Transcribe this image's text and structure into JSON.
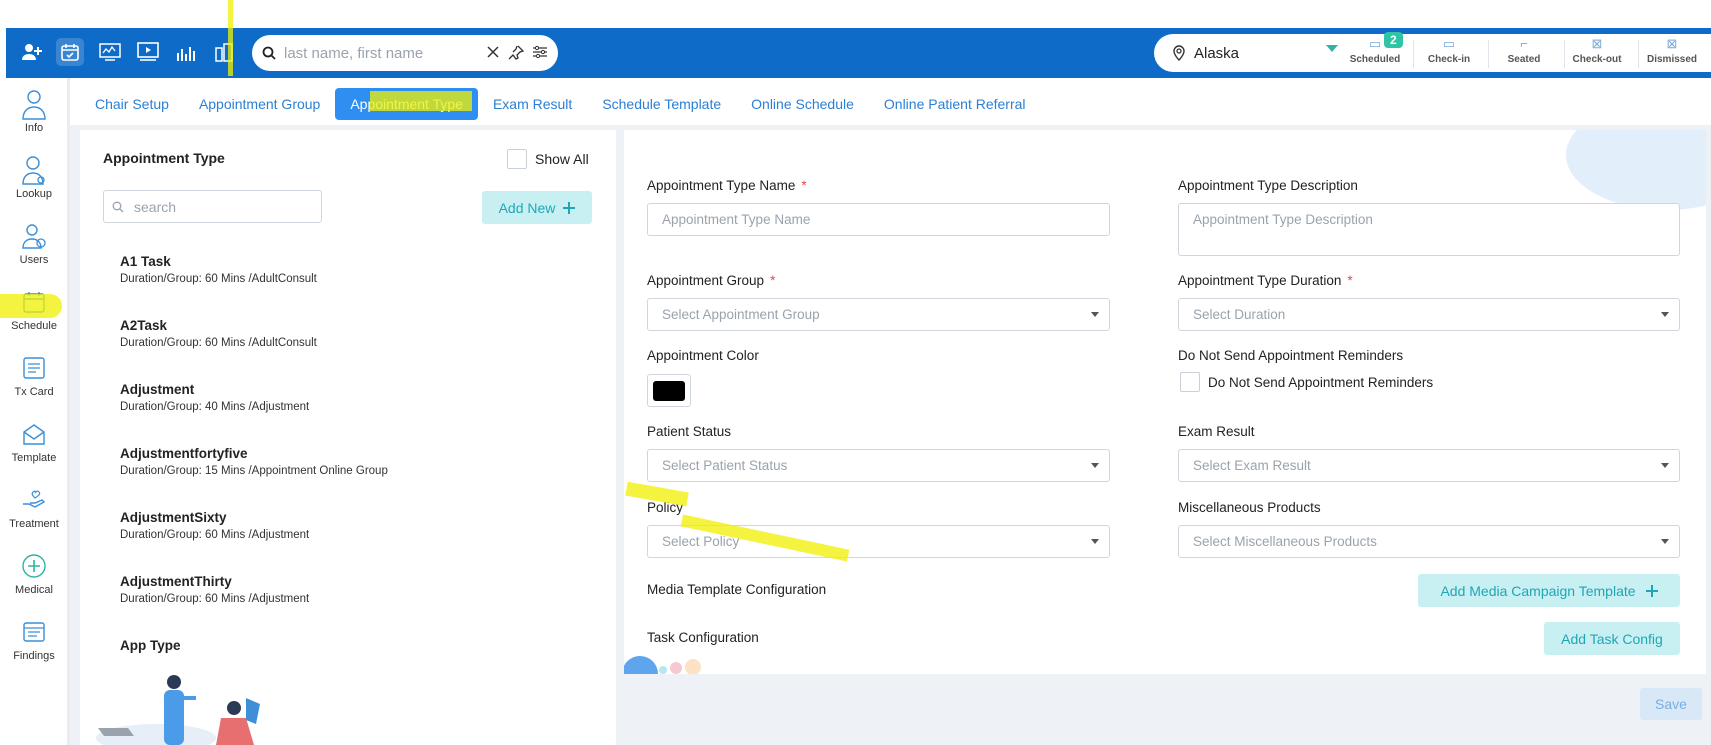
{
  "header": {
    "search_placeholder": "last name, first name",
    "location": "Alaska",
    "stats": [
      {
        "label": "Scheduled",
        "badge": "2"
      },
      {
        "label": "Check-in"
      },
      {
        "label": "Seated"
      },
      {
        "label": "Check-out"
      },
      {
        "label": "Dismissed"
      }
    ]
  },
  "sidebar": {
    "items": [
      {
        "label": "Info",
        "icon": "person-icon"
      },
      {
        "label": "Lookup",
        "icon": "doctor-icon"
      },
      {
        "label": "Users",
        "icon": "users-icon"
      },
      {
        "label": "Schedule",
        "icon": "calendar-icon"
      },
      {
        "label": "Tx Card",
        "icon": "card-icon"
      },
      {
        "label": "Template",
        "icon": "envelope-icon"
      },
      {
        "label": "Treatment",
        "icon": "hand-icon"
      },
      {
        "label": "Medical",
        "icon": "medical-icon"
      },
      {
        "label": "Findings",
        "icon": "findings-icon"
      }
    ]
  },
  "tabs": [
    {
      "label": "Chair Setup"
    },
    {
      "label": "Appointment Group"
    },
    {
      "label": "Appointment Type",
      "active": true
    },
    {
      "label": "Exam Result"
    },
    {
      "label": "Schedule Template"
    },
    {
      "label": "Online Schedule"
    },
    {
      "label": "Online Patient Referral"
    }
  ],
  "left_panel": {
    "title": "Appointment Type",
    "show_all": "Show All",
    "search_placeholder": "search",
    "add_new": "Add New",
    "items": [
      {
        "name": "A1 Task",
        "meta": "Duration/Group: 60 Mins /AdultConsult"
      },
      {
        "name": "A2Task",
        "meta": "Duration/Group: 60 Mins /AdultConsult"
      },
      {
        "name": "Adjustment",
        "meta": "Duration/Group: 40 Mins /Adjustment"
      },
      {
        "name": "Adjustmentfortyfive",
        "meta": "Duration/Group: 15 Mins /Appointment Online Group"
      },
      {
        "name": "AdjustmentSixty",
        "meta": "Duration/Group: 60 Mins /Adjustment"
      },
      {
        "name": "AdjustmentThirty",
        "meta": "Duration/Group: 60 Mins /Adjustment"
      },
      {
        "name": "App Type",
        "meta": ""
      }
    ]
  },
  "form": {
    "type_name_label": "Appointment Type Name",
    "type_name_placeholder": "Appointment Type Name",
    "type_desc_label": "Appointment Type Description",
    "type_desc_placeholder": "Appointment Type Description",
    "group_label": "Appointment Group",
    "group_placeholder": "Select Appointment Group",
    "duration_label": "Appointment Type Duration",
    "duration_placeholder": "Select Duration",
    "color_label": "Appointment Color",
    "color_value": "#000000",
    "dnr_label": "Do Not Send Appointment Reminders",
    "dnr_checkbox": "Do Not Send Appointment Reminders",
    "patient_status_label": "Patient Status",
    "patient_status_placeholder": "Select Patient Status",
    "exam_result_label": "Exam Result",
    "exam_result_placeholder": "Select Exam Result",
    "policy_label": "Policy",
    "policy_placeholder": "Select Policy",
    "misc_label": "Miscellaneous Products",
    "misc_placeholder": "Select Miscellaneous Products",
    "media_label": "Media Template Configuration",
    "media_button": "Add Media Campaign Template",
    "task_label": "Task Configuration",
    "task_button": "Add Task Config",
    "required_mark": "*"
  },
  "save": "Save",
  "colors": {
    "primary": "#0e6bc7",
    "accent": "#2e8ef2",
    "teal": "#1fa6b5"
  }
}
